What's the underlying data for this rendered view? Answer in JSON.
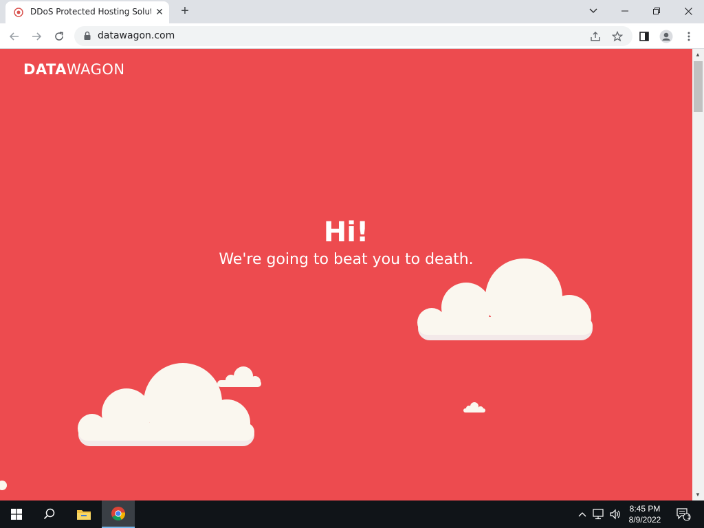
{
  "browser": {
    "tab_title": "DDoS Protected Hosting Solutions",
    "url": "datawagon.com",
    "icons": [
      "favicon-icon",
      "close-icon",
      "plus-icon",
      "chevron-down-icon",
      "minimize-icon",
      "restore-icon",
      "close-window-icon",
      "back-icon",
      "forward-icon",
      "reload-icon",
      "lock-icon",
      "share-icon",
      "star-icon",
      "sidepanel-icon",
      "profile-icon",
      "kebab-menu-icon"
    ]
  },
  "page": {
    "logo_bold": "DATA",
    "logo_light": "WAGON",
    "hero_title": "Hi!",
    "hero_subtitle": "We're going to beat you to death.",
    "background_color": "#ed4b4f"
  },
  "taskbar": {
    "time": "8:45 PM",
    "date": "8/9/2022",
    "notification_count": "1",
    "icons": [
      "windows-start-icon",
      "search-icon",
      "file-explorer-icon",
      "chrome-icon",
      "chevron-up-icon",
      "network-icon",
      "volume-icon",
      "notification-icon"
    ]
  }
}
